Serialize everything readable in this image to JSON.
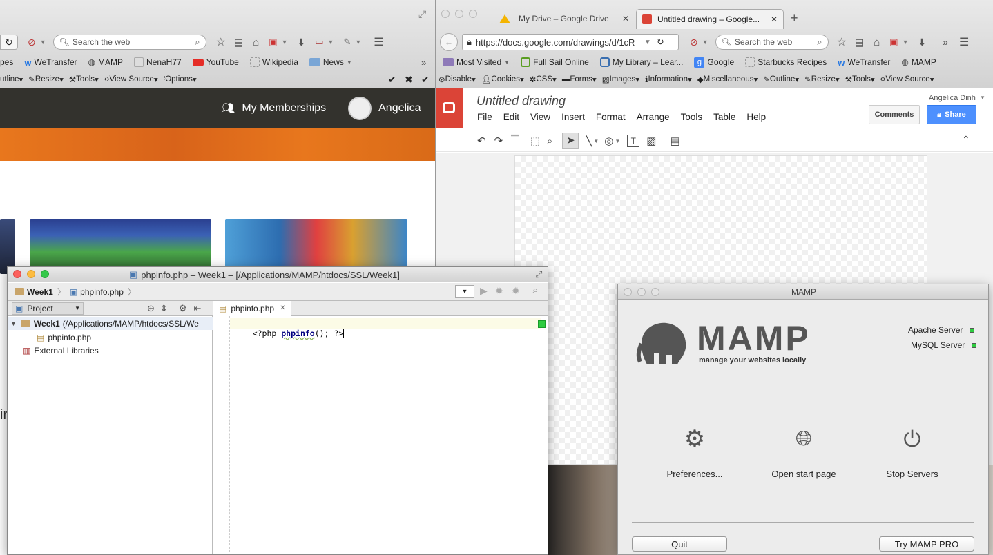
{
  "left_browser": {
    "search_placeholder": "Search the web",
    "bookmarks": [
      {
        "label": "pes",
        "icon": "folder-icon"
      },
      {
        "label": "WeTransfer",
        "icon": "wetransfer-icon"
      },
      {
        "label": "MAMP",
        "icon": "mamp-icon"
      },
      {
        "label": "NenaH77",
        "icon": "page-icon"
      },
      {
        "label": "YouTube",
        "icon": "youtube-icon"
      },
      {
        "label": "Wikipedia",
        "icon": "page-icon"
      },
      {
        "label": "News",
        "icon": "folder-icon"
      }
    ],
    "devbar": [
      "utline",
      "Resize",
      "Tools",
      "View Source",
      "Options"
    ],
    "site": {
      "memberships": "My Memberships",
      "user": "Angelica"
    }
  },
  "right_browser": {
    "tabs": [
      {
        "label": "My Drive – Google Drive",
        "active": false
      },
      {
        "label": "Untitled drawing – Google...",
        "active": true
      }
    ],
    "url": "https://docs.google.com/drawings/d/1cR",
    "search_placeholder": "Search the web",
    "bookmarks": [
      "Most Visited",
      "Full Sail Online",
      "My Library – Lear...",
      "Google",
      "Starbucks Recipes",
      "WeTransfer",
      "MAMP"
    ],
    "devbar": [
      "Disable",
      "Cookies",
      "CSS",
      "Forms",
      "Images",
      "Information",
      "Miscellaneous",
      "Outline",
      "Resize",
      "Tools",
      "View Source"
    ],
    "doc": {
      "title": "Untitled drawing",
      "user": "Angelica Dinh",
      "menus": [
        "File",
        "Edit",
        "View",
        "Insert",
        "Format",
        "Arrange",
        "Tools",
        "Table",
        "Help"
      ],
      "comments": "Comments",
      "share": "Share"
    }
  },
  "ide": {
    "title": "phpinfo.php – Week1 – [/Applications/MAMP/htdocs/SSL/Week1]",
    "breadcrumb": [
      "Week1",
      "phpinfo.php"
    ],
    "project_label": "Project",
    "tree": [
      {
        "label": "Week1",
        "detail": "(/Applications/MAMP/htdocs/SSL/We",
        "level": 0
      },
      {
        "label": "phpinfo.php",
        "detail": "",
        "level": 1
      },
      {
        "label": "External Libraries",
        "detail": "",
        "level": 0
      }
    ],
    "tab": "phpinfo.php",
    "code_open": "<?php ",
    "code_func": "phpinfo",
    "code_close": "(); ?>"
  },
  "mamp": {
    "title": "MAMP",
    "logo": "MAMP",
    "tagline": "manage your websites locally",
    "servers": [
      "Apache Server",
      "MySQL Server"
    ],
    "actions": [
      "Preferences...",
      "Open start page",
      "Stop Servers"
    ],
    "quit": "Quit",
    "pro": "Try MAMP PRO"
  },
  "colors": {
    "site_header": "#33322d",
    "site_banner": "#e8771d",
    "drawings_red": "#db4437",
    "share_blue": "#4d90fe",
    "status_green": "#2ecc40"
  }
}
